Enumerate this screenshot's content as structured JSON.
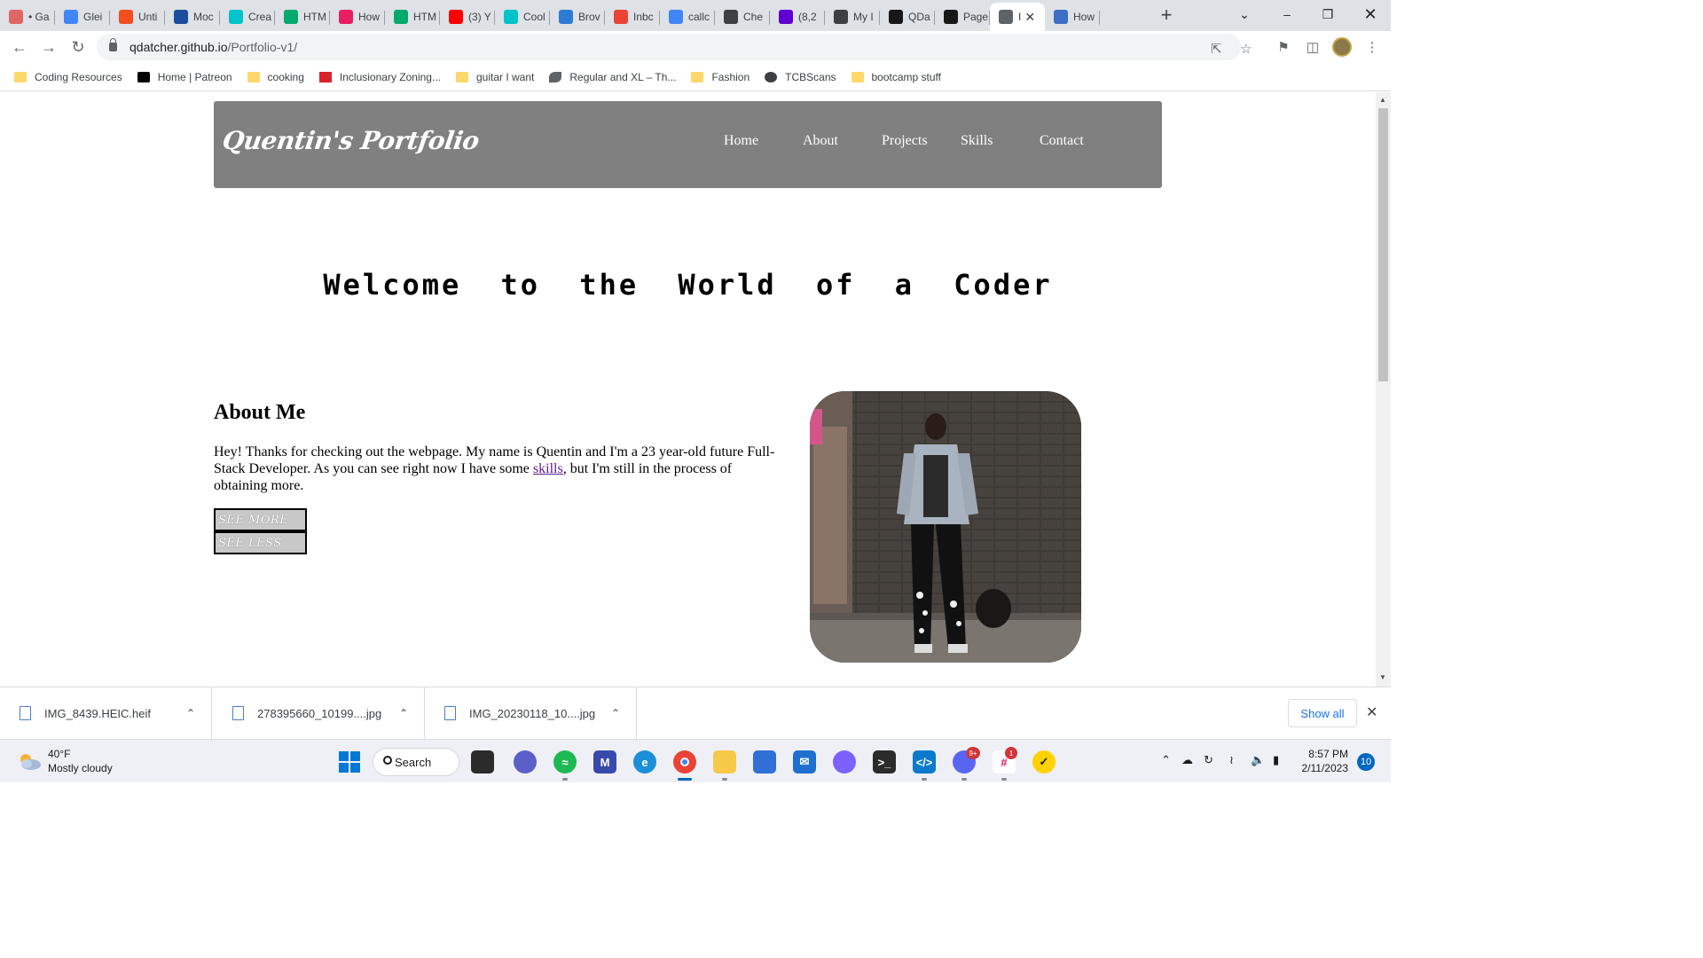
{
  "browser": {
    "tabs": [
      {
        "title": "• Ga",
        "icon": "dots-icon",
        "color": "#e06666"
      },
      {
        "title": "Glei",
        "icon": "google-icon",
        "color": "#4285f4"
      },
      {
        "title": "Unti",
        "icon": "figma-icon",
        "color": "#f24e1e"
      },
      {
        "title": "Moc",
        "icon": "gw-icon",
        "color": "#1b4f9c"
      },
      {
        "title": "Crea",
        "icon": "canva-icon",
        "color": "#00c4cc"
      },
      {
        "title": "HTM",
        "icon": "w3-icon",
        "color": "#04aa6d"
      },
      {
        "title": "How",
        "icon": "p-icon",
        "color": "#e91e63"
      },
      {
        "title": "HTM",
        "icon": "w3-icon",
        "color": "#04aa6d"
      },
      {
        "title": "(3) Y",
        "icon": "youtube-icon",
        "color": "#ff0000"
      },
      {
        "title": "Cool",
        "icon": "canva-icon",
        "color": "#00c4cc"
      },
      {
        "title": "Brov",
        "icon": "puzzle-icon",
        "color": "#2e7bd6"
      },
      {
        "title": "Inbc",
        "icon": "gmail-icon",
        "color": "#ea4335"
      },
      {
        "title": "callc",
        "icon": "google-icon",
        "color": "#4285f4"
      },
      {
        "title": "Che",
        "icon": "doc-icon",
        "color": "#3c4043"
      },
      {
        "title": "(8,2",
        "icon": "mail-icon",
        "color": "#6001d2"
      },
      {
        "title": "My I",
        "icon": "doc-icon",
        "color": "#3c4043"
      },
      {
        "title": "QDa",
        "icon": "github-icon",
        "color": "#181717"
      },
      {
        "title": "Page",
        "icon": "github-icon",
        "color": "#181717"
      },
      {
        "title": "I",
        "icon": "globe-icon",
        "color": "#5f6368",
        "active": true
      },
      {
        "title": "How",
        "icon": "window-icon",
        "color": "#3b6fc4"
      }
    ],
    "url_host": "qdatcher.github.io",
    "url_path": "/Portfolio-v1/",
    "bookmarks": [
      {
        "label": "Coding Resources",
        "icon": "folder-icon"
      },
      {
        "label": "Home | Patreon",
        "icon": "patreon-icon"
      },
      {
        "label": "cooking",
        "icon": "folder-icon"
      },
      {
        "label": "Inclusionary Zoning...",
        "icon": "flag-icon"
      },
      {
        "label": "guitar I want",
        "icon": "folder-icon"
      },
      {
        "label": "Regular and XL – Th...",
        "icon": "leaf-icon"
      },
      {
        "label": "Fashion",
        "icon": "folder-icon"
      },
      {
        "label": "TCBScans",
        "icon": "globe-icon"
      },
      {
        "label": "bootcamp stuff",
        "icon": "folder-icon"
      }
    ]
  },
  "site": {
    "brand": "Quentin's Portfolio",
    "nav": [
      "Home",
      "About",
      "Projects",
      "Skills",
      "Contact"
    ],
    "welcome": "Welcome to the World of a Coder",
    "about_title": "About Me",
    "about_text_before": "Hey! Thanks for checking out the webpage. My name is Quentin and I'm a 23 year-old future Full-Stack Developer. As you can see right now I have some ",
    "about_link": "skills",
    "about_text_after": ", but I'm still in the process of obtaining more.",
    "btn_more": "SEE MORE",
    "btn_less": "SEE LESS",
    "header_color": "#808080"
  },
  "downloads": {
    "files": [
      "IMG_8439.HEIC.heif",
      "278395660_10199....jpg",
      "IMG_20230118_10....jpg"
    ],
    "show_all": "Show all"
  },
  "taskbar": {
    "temp": "40°F",
    "weather": "Mostly cloudy",
    "search": "Search",
    "time": "8:57 PM",
    "date": "2/11/2023",
    "notifications": "10",
    "discord_badge": "9+",
    "slack_badge": "1"
  }
}
